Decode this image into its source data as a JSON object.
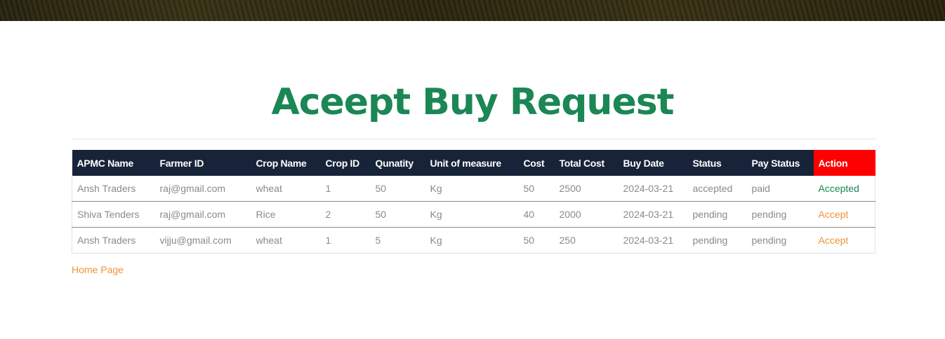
{
  "page": {
    "title": "Aceept Buy Request",
    "home_link": "Home Page"
  },
  "table": {
    "headers": [
      "APMC Name",
      "Farmer ID",
      "Crop Name",
      "Crop ID",
      "Qunatity",
      "Unit of measure",
      "Cost",
      "Total Cost",
      "Buy Date",
      "Status",
      "Pay Status",
      "Action"
    ],
    "rows": [
      {
        "apmc_name": "Ansh Traders",
        "farmer_id": "raj@gmail.com",
        "crop_name": "wheat",
        "crop_id": "1",
        "quantity": "50",
        "unit": "Kg",
        "cost": "50",
        "total_cost": "2500",
        "buy_date": "2024-03-21",
        "status": "accepted",
        "pay_status": "paid",
        "action": "Accepted"
      },
      {
        "apmc_name": "Shiva Tenders",
        "farmer_id": "raj@gmail.com",
        "crop_name": "Rice",
        "crop_id": "2",
        "quantity": "50",
        "unit": "Kg",
        "cost": "40",
        "total_cost": "2000",
        "buy_date": "2024-03-21",
        "status": "pending",
        "pay_status": "pending",
        "action": "Accept"
      },
      {
        "apmc_name": "Ansh Traders",
        "farmer_id": "vijju@gmail.com",
        "crop_name": "wheat",
        "crop_id": "1",
        "quantity": "5",
        "unit": "Kg",
        "cost": "50",
        "total_cost": "250",
        "buy_date": "2024-03-21",
        "status": "pending",
        "pay_status": "pending",
        "action": "Accept"
      }
    ]
  },
  "colors": {
    "title": "#1a8754",
    "header_bg": "#172338",
    "action_header_bg": "#ff0000",
    "accept_link": "#f0923a",
    "accepted_link": "#1a8754"
  }
}
